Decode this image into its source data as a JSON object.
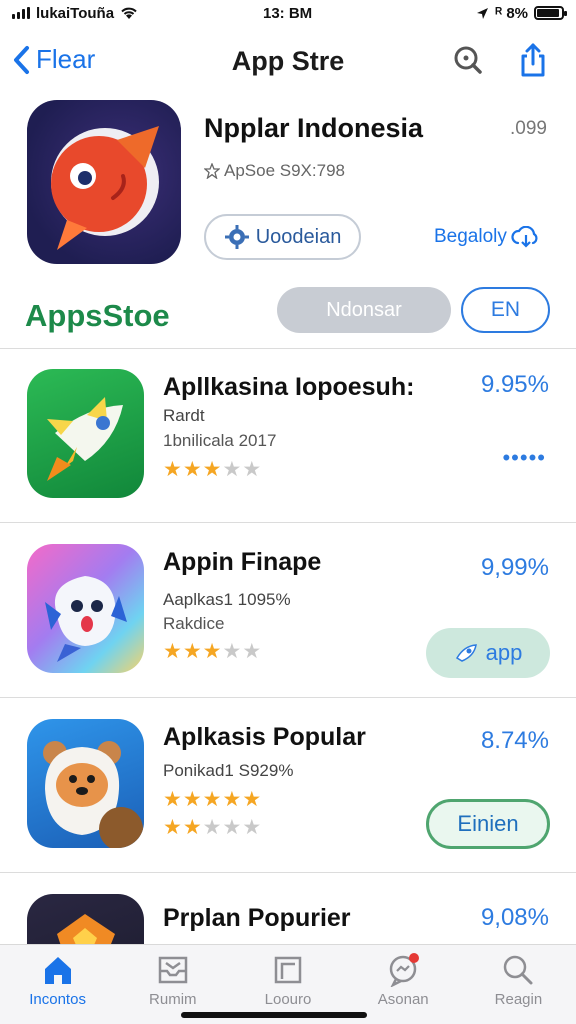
{
  "status_bar": {
    "carrier": "lukaiTouña",
    "time": "13: BM",
    "battery": "ᴿ 8%",
    "battery_level": 0.9
  },
  "nav": {
    "back_label": "Flear",
    "title": "App Stre",
    "search_icon": "search-icon",
    "share_icon": "share-icon"
  },
  "featured": {
    "title": "Npplar Indonesia",
    "price": ".099",
    "subtitle": "ApSoe S9X:798",
    "download_label": "Uoodeian",
    "beta_label": "Begaloly"
  },
  "section": {
    "title": "AppsStoe",
    "segment_label": "Ndonsar",
    "lang_label": "EN"
  },
  "apps": [
    {
      "name": "Apllkasina Iopoesuh:",
      "line1": "Rardt",
      "line2": "1bnilicala 2017",
      "rating": 3,
      "price": "9.95%",
      "action": "•••••",
      "colors": [
        "#1fa64a",
        "#0f7f34"
      ]
    },
    {
      "name": "Appin Finape",
      "line1": "Aaplkas1 1095%",
      "line2": "Rakdice",
      "rating": 3,
      "price": "9,99%",
      "action": "app",
      "colors": [
        "#f06ac8",
        "#5fd0f0"
      ]
    },
    {
      "name": "Aplkasis Popular",
      "line1": "Ponikad1 S929%",
      "rating": 5,
      "rating2": 2,
      "price": "8.74%",
      "action": "Einien",
      "colors": [
        "#2b86e0",
        "#1f63b8"
      ]
    },
    {
      "name": "Prplan Popurier",
      "line1": "",
      "rating": 0,
      "price": "9,08%",
      "action": "",
      "colors": [
        "#26233d",
        "#1a1a2a"
      ]
    }
  ],
  "tabs": [
    {
      "label": "Incontos",
      "icon": "home-icon",
      "active": true
    },
    {
      "label": "Rumim",
      "icon": "inbox-icon",
      "active": false
    },
    {
      "label": "Loouro",
      "icon": "square-icon",
      "active": false
    },
    {
      "label": "Asonan",
      "icon": "chat-icon",
      "active": false,
      "badge": true
    },
    {
      "label": "Reagin",
      "icon": "search-icon",
      "active": false
    }
  ]
}
